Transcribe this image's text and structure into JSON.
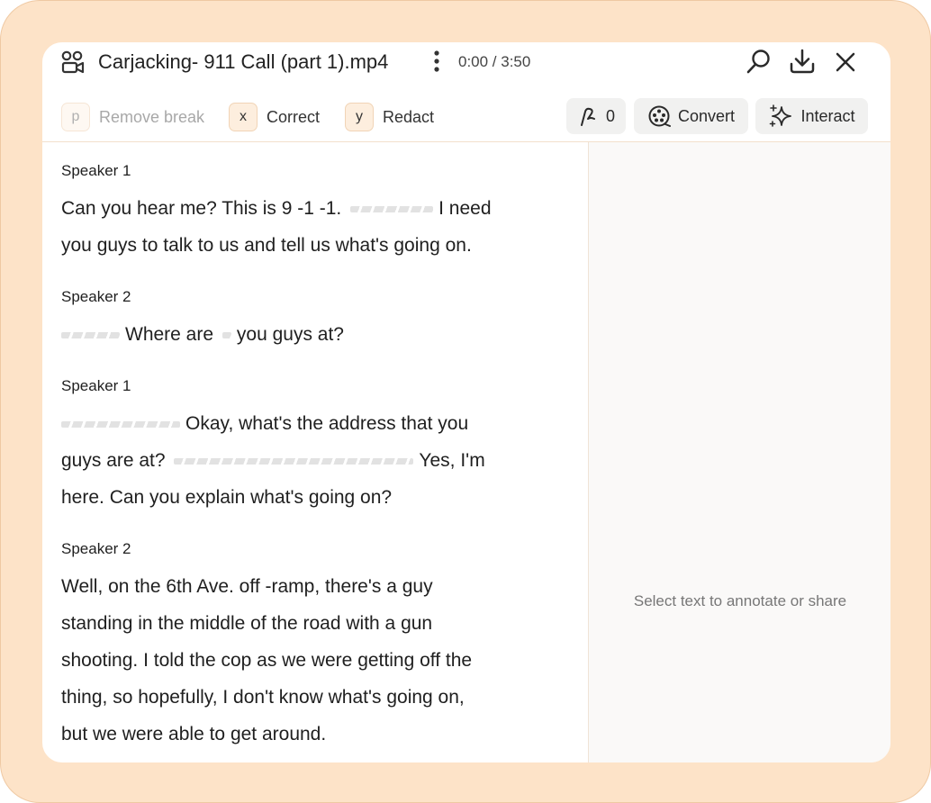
{
  "header": {
    "title": "Carjacking- 911 Call (part 1).mp4",
    "time": "0:00 / 3:50"
  },
  "shortcuts": [
    {
      "key": "p",
      "label": "Remove break",
      "enabled": false
    },
    {
      "key": "x",
      "label": "Correct",
      "enabled": true
    },
    {
      "key": "y",
      "label": "Redact",
      "enabled": true
    }
  ],
  "tools": {
    "annotation_count": "0",
    "convert_label": "Convert",
    "interact_label": "Interact"
  },
  "sidebar": {
    "hint": "Select text to annotate or share"
  },
  "transcript": [
    {
      "speaker": "Speaker 1",
      "lines": [
        "Can you hear me? This is 9 -1 -1.",
        "I need",
        "you guys to talk to us and tell us what's going on."
      ]
    },
    {
      "speaker": "Speaker 2",
      "lines": [
        "Where are",
        "you guys at?"
      ]
    },
    {
      "speaker": "Speaker 1",
      "lines": [
        "Okay, what's the address that you",
        "guys are at?",
        "Yes, I'm",
        "here. Can you explain what's going on?"
      ]
    },
    {
      "speaker": "Speaker 2",
      "lines": [
        "Well, on the 6th Ave. off -ramp, there's a guy",
        "standing in the middle of the road with a gun",
        "shooting. I told the cop as we were getting off the",
        "thing, so hopefully, I don't know what's going on,",
        "but we were able to get around."
      ]
    }
  ],
  "icons": {
    "media": "media-file-icon",
    "more": "more-vertical-icon",
    "search": "search-icon",
    "download": "download-icon",
    "close": "close-icon",
    "annotate": "annotate-icon",
    "convert": "convert-icon",
    "interact": "sparkle-icon"
  }
}
